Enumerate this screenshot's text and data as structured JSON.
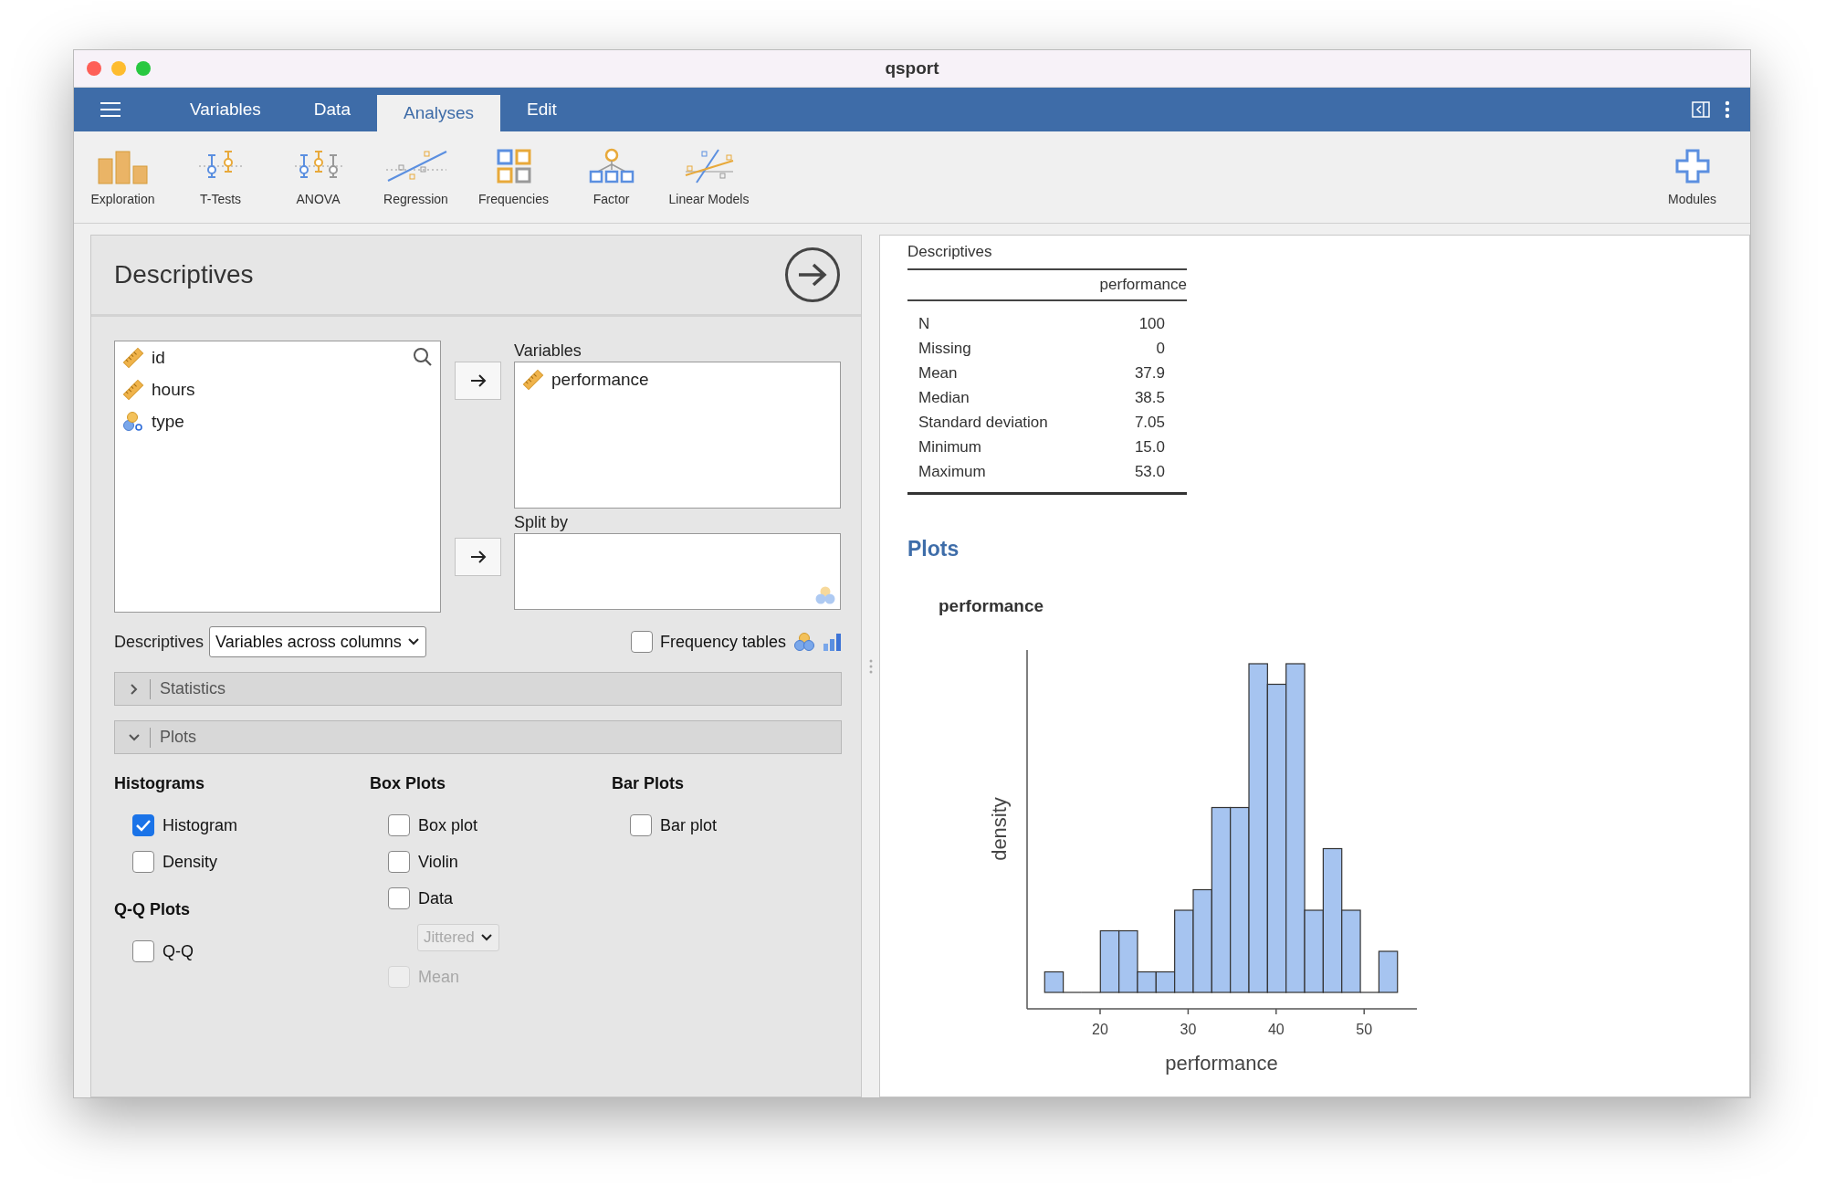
{
  "window": {
    "title": "qsport"
  },
  "menu_tabs": [
    {
      "label": "Variables",
      "selected": false
    },
    {
      "label": "Data",
      "selected": false
    },
    {
      "label": "Analyses",
      "selected": true
    },
    {
      "label": "Edit",
      "selected": false
    }
  ],
  "ribbon": [
    {
      "label": "Exploration"
    },
    {
      "label": "T-Tests"
    },
    {
      "label": "ANOVA"
    },
    {
      "label": "Regression"
    },
    {
      "label": "Frequencies"
    },
    {
      "label": "Factor"
    },
    {
      "label": "Linear Models"
    }
  ],
  "modules": {
    "label": "Modules"
  },
  "analysis": {
    "title": "Descriptives",
    "variable_list": [
      {
        "name": "id",
        "kind": "scale"
      },
      {
        "name": "hours",
        "kind": "scale"
      },
      {
        "name": "type",
        "kind": "nominal"
      }
    ],
    "variables": {
      "label": "Variables",
      "items": [
        {
          "name": "performance",
          "kind": "scale"
        }
      ]
    },
    "split_by": {
      "label": "Split by"
    },
    "descriptives_option": {
      "label": "Descriptives",
      "value": "Variables across columns"
    },
    "frequency_tables": {
      "label": "Frequency tables",
      "checked": false
    },
    "sections": [
      {
        "label": "Statistics",
        "expanded": false
      },
      {
        "label": "Plots",
        "expanded": true
      }
    ],
    "plot_columns": [
      {
        "groups": [
          {
            "heading": "Histograms",
            "options": [
              {
                "kind": "checkbox",
                "label": "Histogram",
                "checked": true,
                "disabled": false
              },
              {
                "kind": "checkbox",
                "label": "Density",
                "checked": false,
                "disabled": false
              }
            ]
          },
          {
            "heading": "Q-Q Plots",
            "options": [
              {
                "kind": "checkbox",
                "label": "Q-Q",
                "checked": false,
                "disabled": false
              }
            ]
          }
        ]
      },
      {
        "groups": [
          {
            "heading": "Box Plots",
            "options": [
              {
                "kind": "checkbox",
                "label": "Box plot",
                "checked": false,
                "disabled": false
              },
              {
                "kind": "checkbox",
                "label": "Violin",
                "checked": false,
                "disabled": false
              },
              {
                "kind": "checkbox",
                "label": "Data",
                "checked": false,
                "disabled": false
              },
              {
                "kind": "select",
                "label": "Jittered",
                "disabled": true
              },
              {
                "kind": "checkbox",
                "label": "Mean",
                "checked": false,
                "disabled": true
              }
            ]
          }
        ]
      },
      {
        "groups": [
          {
            "heading": "Bar Plots",
            "options": [
              {
                "kind": "checkbox",
                "label": "Bar plot",
                "checked": false,
                "disabled": false
              }
            ]
          }
        ]
      }
    ]
  },
  "results": {
    "table": {
      "title": "Descriptives",
      "columns": [
        "performance"
      ],
      "rows": [
        {
          "label": "N",
          "value": "100"
        },
        {
          "label": "Missing",
          "value": "0"
        },
        {
          "label": "Mean",
          "value": "37.9"
        },
        {
          "label": "Median",
          "value": "38.5"
        },
        {
          "label": "Standard deviation",
          "value": "7.05"
        },
        {
          "label": "Minimum",
          "value": "15.0"
        },
        {
          "label": "Maximum",
          "value": "53.0"
        }
      ]
    },
    "plots_heading": "Plots",
    "plot": {
      "title": "performance",
      "xlabel": "performance",
      "ylabel": "density",
      "xtick_labels": [
        "20",
        "30",
        "40",
        "50"
      ]
    }
  }
}
